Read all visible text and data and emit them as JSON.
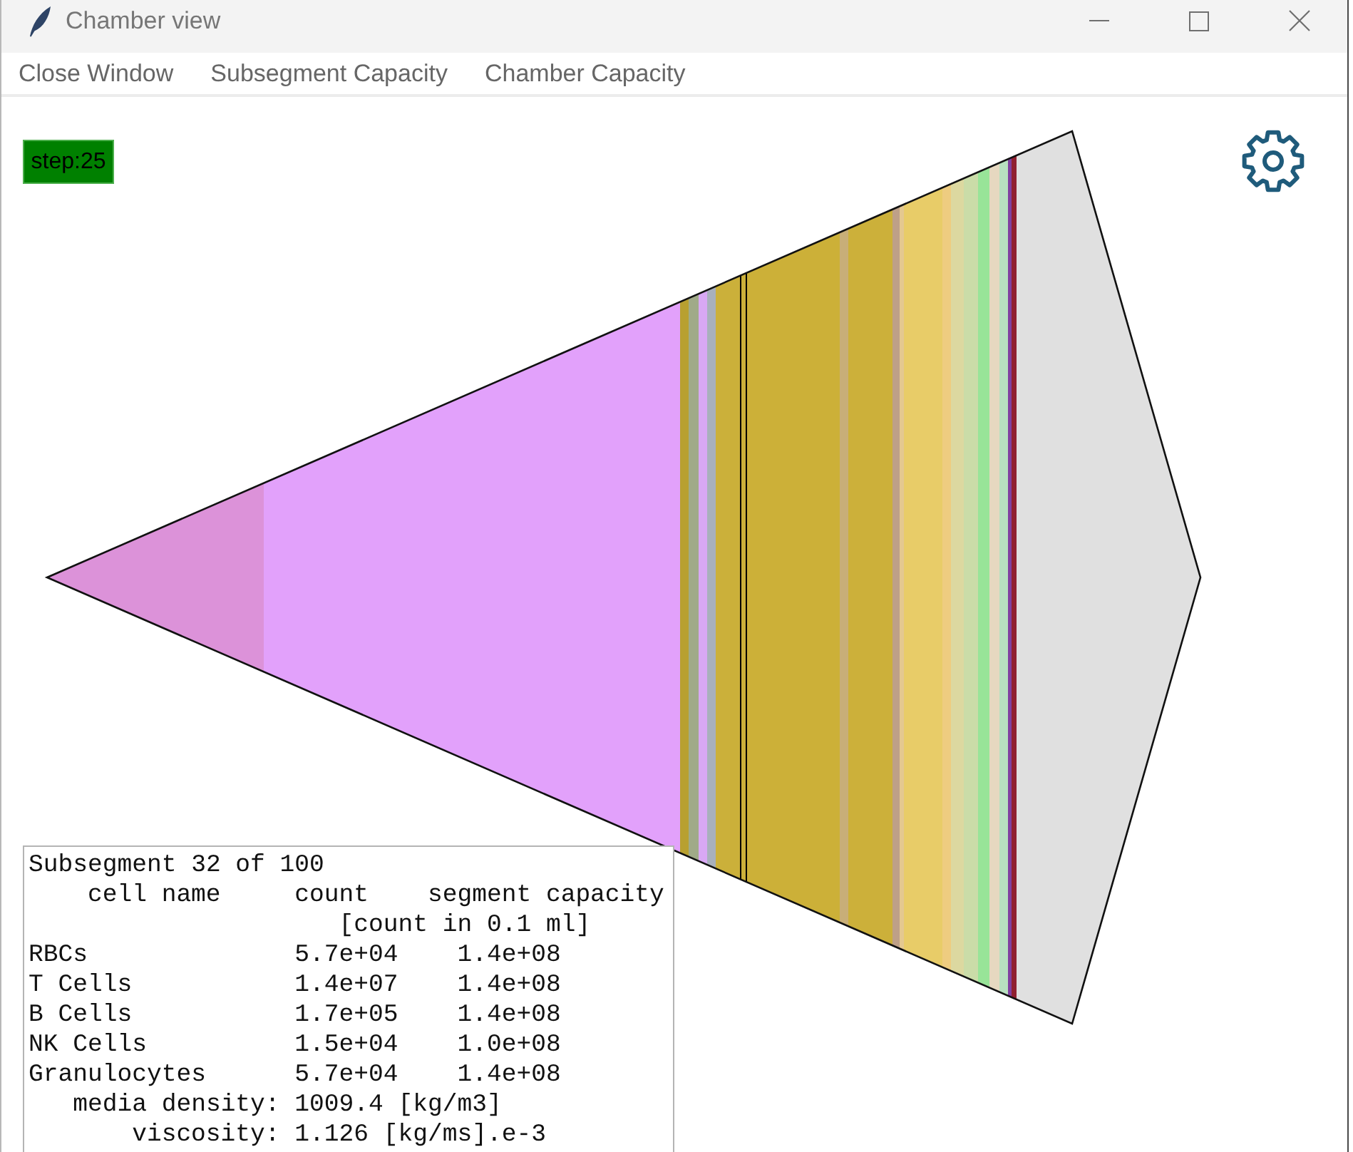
{
  "window": {
    "title": "Chamber view"
  },
  "menu": [
    "Close Window",
    "Subsegment Capacity",
    "Chamber Capacity"
  ],
  "step_label": "step:25",
  "chamber": {
    "segments": [
      {
        "color": "#dc92d9",
        "selected": false
      },
      {
        "color": "#e2a1fb",
        "selected": false
      },
      {
        "color": "#b8a030",
        "selected": false
      },
      {
        "color": "#a0aa88",
        "selected": false
      },
      {
        "color": "#d8a8f4",
        "selected": false
      },
      {
        "color": "#a8b0bc",
        "selected": false
      },
      {
        "color": "#cbb03a",
        "selected": false
      },
      {
        "color": "#cbb03a",
        "selected": true
      },
      {
        "color": "#ccb038",
        "selected": false
      },
      {
        "color": "#c8ae78",
        "selected": false
      },
      {
        "color": "#ccb03a",
        "selected": false
      },
      {
        "color": "#bea088",
        "selected": false
      },
      {
        "color": "#e4c890",
        "selected": false
      },
      {
        "color": "#e8cc68",
        "selected": false
      },
      {
        "color": "#eecc80",
        "selected": false
      },
      {
        "color": "#dcd8a0",
        "selected": false
      },
      {
        "color": "#cadca8",
        "selected": false
      },
      {
        "color": "#98e498",
        "selected": false
      },
      {
        "color": "#e6d8c0",
        "selected": false
      },
      {
        "color": "#b8e0c0",
        "selected": false
      },
      {
        "color": "#8040a0",
        "selected": false
      },
      {
        "color": "#902030",
        "selected": false
      }
    ]
  },
  "info_panel": {
    "title": "Subsegment 32 of 100",
    "columns": [
      "cell name",
      "count",
      "segment capacity"
    ],
    "unit_note": "[count in 0.1 ml]",
    "rows": [
      {
        "cell_name": "RBCs",
        "count": "5.7e+04",
        "capacity": "1.4e+08"
      },
      {
        "cell_name": "T Cells",
        "count": "1.4e+07",
        "capacity": "1.4e+08"
      },
      {
        "cell_name": "B Cells",
        "count": "1.7e+05",
        "capacity": "1.4e+08"
      },
      {
        "cell_name": "NK Cells",
        "count": "1.5e+04",
        "capacity": "1.0e+08"
      },
      {
        "cell_name": "Granulocytes",
        "count": "5.7e+04",
        "capacity": "1.4e+08"
      }
    ],
    "properties": [
      {
        "label": "media density:",
        "value": "1009.4 [kg/m3]"
      },
      {
        "label": "viscosity:",
        "value": "1.126 [kg/ms].e-3"
      }
    ]
  }
}
